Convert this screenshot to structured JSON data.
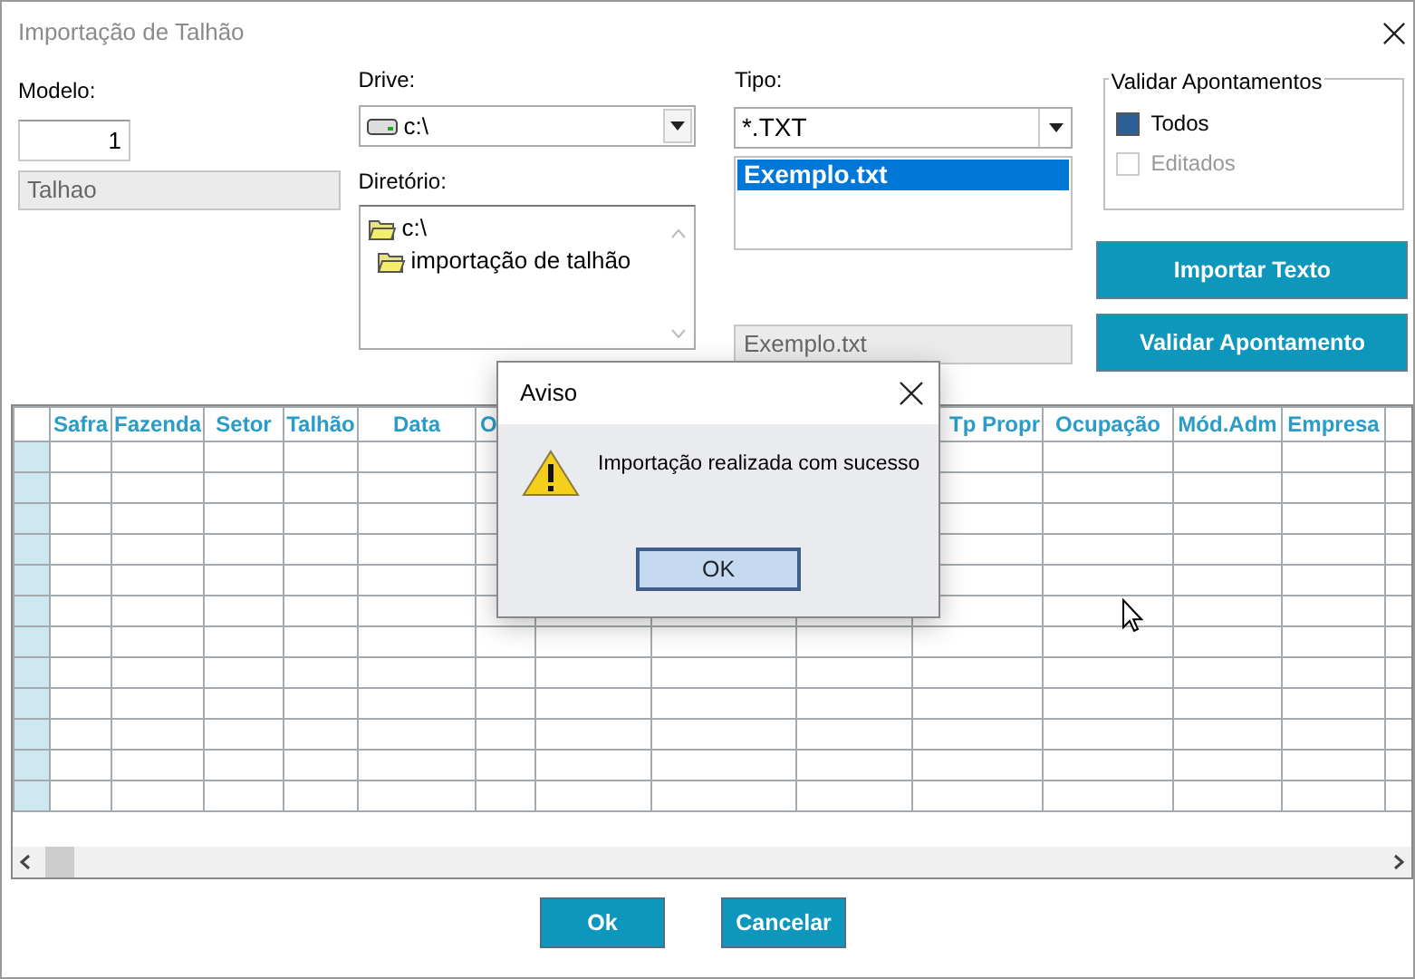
{
  "window": {
    "title": "Importação de Talhão"
  },
  "modelo": {
    "label": "Modelo:",
    "value": "1",
    "description": "Talhao"
  },
  "drive": {
    "label": "Drive:",
    "value": "c:\\"
  },
  "directory": {
    "label": "Diretório:",
    "items": [
      {
        "label": "c:\\",
        "children": [
          {
            "label": "importação de talhão"
          }
        ]
      }
    ]
  },
  "tipo": {
    "label": "Tipo:",
    "value": "*.TXT",
    "files": [
      {
        "label": "Exemplo.txt",
        "selected": true
      }
    ],
    "filename": "Exemplo.txt"
  },
  "validar_apontamentos": {
    "title": "Validar Apontamentos",
    "options": [
      {
        "label": "Todos",
        "checked": true,
        "disabled": false
      },
      {
        "label": "Editados",
        "checked": false,
        "disabled": true
      }
    ]
  },
  "action_buttons": [
    "Importar Texto",
    "Validar Apontamento"
  ],
  "table": {
    "columns_left": [
      "Safra",
      "Fazenda",
      "Setor",
      "Talhão",
      "Data",
      "O"
    ],
    "columns_right": [
      "Tp Propr",
      "Ocupação",
      "Mód.Adm",
      "Empresa"
    ]
  },
  "footer_buttons": [
    "Ok",
    "Cancelar"
  ],
  "dialog": {
    "title": "Aviso",
    "message": "Importação realizada com sucesso",
    "button": "OK"
  }
}
